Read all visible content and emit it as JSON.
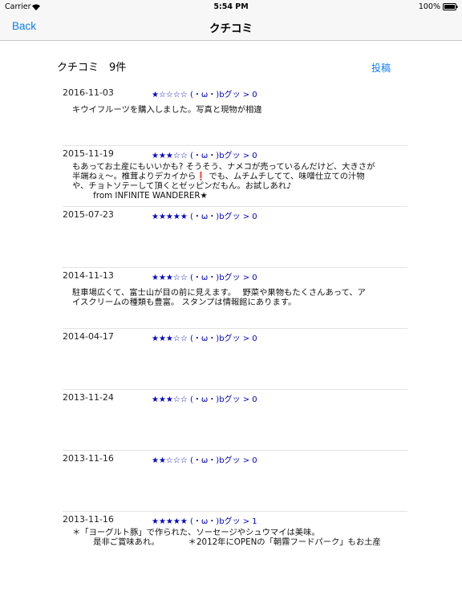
{
  "status": {
    "carrier": "Carrier",
    "time": "5:54 PM",
    "battery": "100%"
  },
  "nav": {
    "back_label": "Back",
    "title": "クチコミ"
  },
  "header": {
    "title": "クチコミ　9件",
    "post_label": "投稿"
  },
  "reviews": [
    {
      "date": "2016-11-03",
      "stars": "★☆☆☆☆",
      "likes": "(・ω・)bグッ > 0",
      "body": "キウイフルーツを購入しました。写真と現物が相違"
    },
    {
      "date": "2015-11-19",
      "stars": "★★★☆☆",
      "likes": "(・ω・)bグッ > 0",
      "body": "もあってお土産にもいいかも? そうそう、ナメコが売っているんだけど、大きさが\n半端ねぇ～。椎茸よりデカイから❗ でも、ムチムチしてて、味噌仕立ての汁物\nや、チョトソテーして頂くとゼッピンだもん。お試しあれ♪\n        from INFINITE WANDERER★"
    },
    {
      "date": "2015-07-23",
      "stars": "★★★★★",
      "likes": "(・ω・)bグッ > 0",
      "body": ""
    },
    {
      "date": "2014-11-13",
      "stars": "★★★☆☆",
      "likes": "(・ω・)bグッ > 0",
      "body": "駐車場広くて、富士山が目の前に見えます。　 野菜や果物もたくさんあって、ア\nイスクリームの種類も豊富。 スタンプは情報館にあります。"
    },
    {
      "date": "2014-04-17",
      "stars": "★★★☆☆",
      "likes": "(・ω・)bグッ > 0",
      "body": ""
    },
    {
      "date": "2013-11-24",
      "stars": "★★★☆☆",
      "likes": "(・ω・)bグッ > 0",
      "body": ""
    },
    {
      "date": "2013-11-16",
      "stars": "★★☆☆☆",
      "likes": "(・ω・)bグッ > 0",
      "body": ""
    },
    {
      "date": "2013-11-16",
      "stars": "★★★★★",
      "likes": "(・ω・)bグッ > 1",
      "body": "＊「ヨーグルト豚」で作られた、ソーセージやシュウマイは美味。\n        是非ご賞味あれ。           ＊2012年にOPENの「朝霧フードパーク」もお土産"
    }
  ]
}
